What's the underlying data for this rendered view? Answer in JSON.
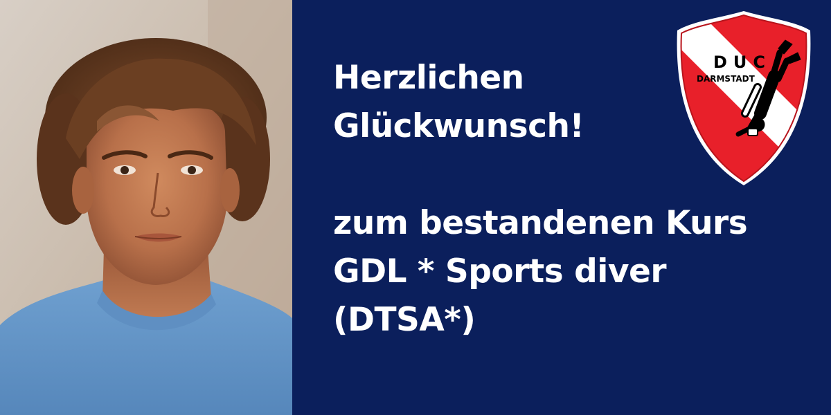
{
  "greeting": {
    "line1": "Herzlichen",
    "line2": "Glückwunsch!"
  },
  "message": {
    "line1": "zum bestandenen Kurs",
    "line2": "GDL * Sports diver",
    "line3": "(DTSA*)"
  },
  "logo": {
    "letters": "DUC",
    "city": "DARMSTADT"
  },
  "colors": {
    "background": "#0b1f5c",
    "text": "#ffffff",
    "logo_red": "#e8202a"
  },
  "icons": {
    "logo": "diver-flag-shield-icon"
  }
}
